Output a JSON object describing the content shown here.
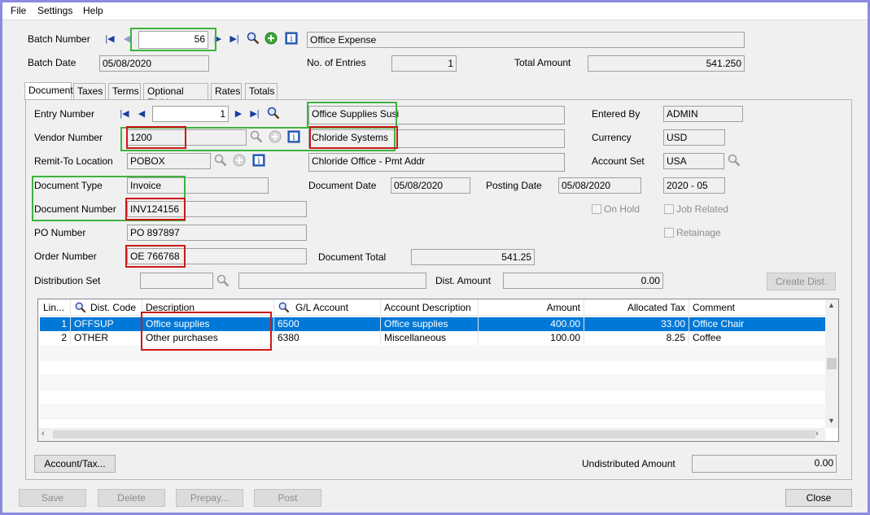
{
  "menu": [
    "File",
    "Settings",
    "Help"
  ],
  "batch": {
    "number_label": "Batch Number",
    "number": "56",
    "description": "Office Expense",
    "date_label": "Batch Date",
    "date": "05/08/2020",
    "entries_label": "No. of Entries",
    "entries": "1",
    "total_label": "Total Amount",
    "total": "541.250"
  },
  "tabs": [
    {
      "label": "Document"
    },
    {
      "label": "Taxes"
    },
    {
      "label": "Terms"
    },
    {
      "label": "Optional Fields"
    },
    {
      "label": "Rates"
    },
    {
      "label": "Totals"
    }
  ],
  "doc": {
    "entry_label": "Entry Number",
    "entry": "1",
    "entry_desc": "Office Supplies Susi",
    "entered_by_label": "Entered By",
    "entered_by": "ADMIN",
    "vendor_label": "Vendor Number",
    "vendor": "1200",
    "vendor_name": "Chloride Systems",
    "currency_label": "Currency",
    "currency": "USD",
    "remit_label": "Remit-To Location",
    "remit": "POBOX",
    "remit_name": "Chloride Office - Pmt Addr",
    "account_set_label": "Account Set",
    "account_set": "USA",
    "doc_type_label": "Document Type",
    "doc_type": "Invoice",
    "doc_date_label": "Document Date",
    "doc_date": "05/08/2020",
    "posting_date_label": "Posting Date",
    "posting_date": "05/08/2020",
    "period": "2020 - 05",
    "doc_number_label": "Document Number",
    "doc_number": "INV124156",
    "on_hold_label": "On Hold",
    "job_related_label": "Job Related",
    "po_label": "PO Number",
    "po": "PO 897897",
    "retainage_label": "Retainage",
    "order_label": "Order Number",
    "order": "OE 766768",
    "doc_total_label": "Document Total",
    "doc_total": "541.25",
    "dist_set_label": "Distribution Set",
    "dist_amount_label": "Dist. Amount",
    "dist_amount": "0.00",
    "create_dist_label": "Create Dist."
  },
  "grid": {
    "headers": [
      "Lin...",
      "Dist. Code",
      "Description",
      "G/L Account",
      "Account Description",
      "Amount",
      "Allocated Tax",
      "Comment"
    ],
    "rows": [
      {
        "line": "1",
        "code": "OFFSUP",
        "desc": "Office supplies",
        "gl": "6500",
        "acct_desc": "Office supplies",
        "amount": "400.00",
        "tax": "33.00",
        "comment": "Office Chair"
      },
      {
        "line": "2",
        "code": "OTHER",
        "desc": "Other purchases",
        "gl": "6380",
        "acct_desc": "Miscellaneous",
        "amount": "100.00",
        "tax": "8.25",
        "comment": "Coffee"
      }
    ]
  },
  "footer": {
    "account_tax_label": "Account/Tax...",
    "undistributed_label": "Undistributed Amount",
    "undistributed": "0.00",
    "save": "Save",
    "delete": "Delete",
    "prepay": "Prepay...",
    "post": "Post",
    "close": "Close"
  },
  "colors": {
    "highlight_green": "#3db33d",
    "highlight_red": "#cc1818",
    "selection": "#0078d7"
  }
}
